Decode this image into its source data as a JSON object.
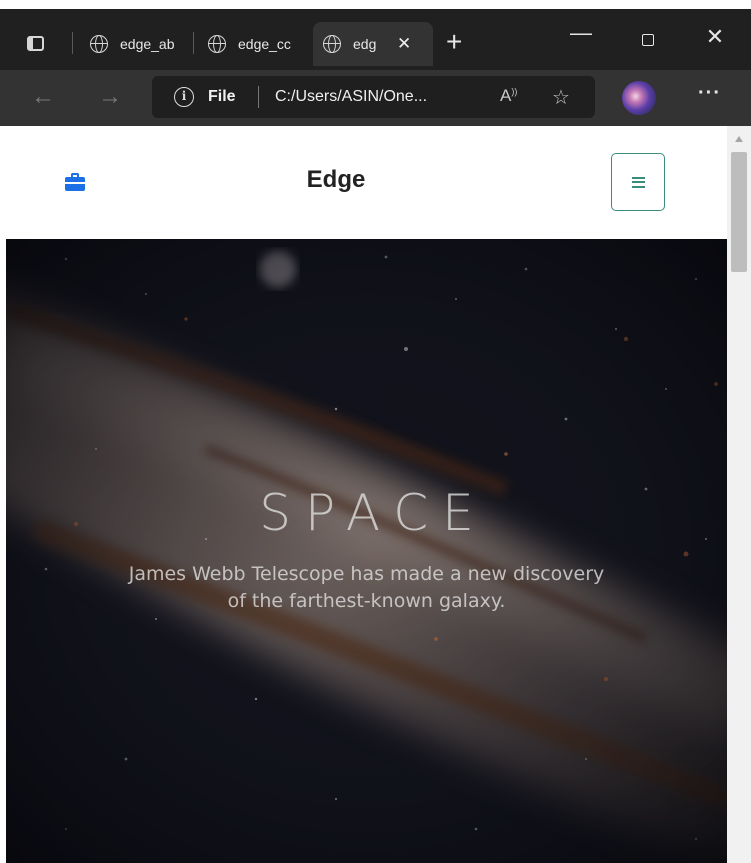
{
  "browser": {
    "tabs": [
      {
        "label": "edge_ab",
        "active": false
      },
      {
        "label": "edge_cc",
        "active": false
      },
      {
        "label": "edg",
        "active": true
      }
    ],
    "tab_close_glyph": "✕",
    "new_tab_glyph": "+",
    "address": {
      "scheme_label": "File",
      "url": "C:/Users/ASIN/One..."
    },
    "icons": [
      "tab-actions-icon",
      "globe-icon",
      "back-arrow-icon",
      "forward-arrow-icon",
      "info-icon",
      "read-aloud-icon",
      "add-favorite-icon",
      "profile-avatar",
      "more-icon",
      "minimize-icon",
      "maximize-icon",
      "close-icon"
    ]
  },
  "site": {
    "brand_title": "Edge",
    "brand_icon": "briefcase-icon",
    "menu_icon": "hamburger-icon",
    "accent_color": "#1c6fe4",
    "toggle_color": "#3a8c7d"
  },
  "hero": {
    "title": "SPACE",
    "subtitle": "James Webb Telescope has made a new discovery of the farthest-known galaxy."
  }
}
